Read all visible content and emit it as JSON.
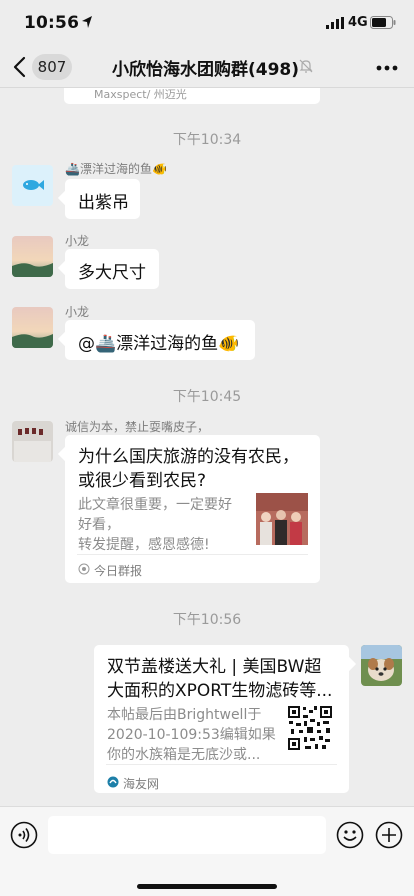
{
  "status_bar": {
    "time": "10:56",
    "network": "4G"
  },
  "header": {
    "back_badge": "807",
    "title": "小欣怡海水团购群(498)"
  },
  "chat": {
    "previous_snippet": "Maxspect/ 州迈光",
    "times": [
      "下午10:34",
      "下午10:45",
      "下午10:56"
    ],
    "messages": [
      {
        "sender": "🚢漂洋过海的鱼🐠",
        "text": "出紫吊"
      },
      {
        "sender": "小龙",
        "text": "多大尺寸"
      },
      {
        "sender": "小龙",
        "text": "@🚢漂洋过海的鱼🐠"
      }
    ],
    "card_left": {
      "sender": "诚信为本，禁止耍嘴皮子，",
      "title_line1": "为什么国庆旅游的没有农民，",
      "title_line2": "或很少看到农民?",
      "desc_line1": "此文章很重要，一定要好",
      "desc_line2": "好看，",
      "desc_line3": "转发提醒，感恩感德!",
      "source": "今日群报"
    },
    "card_right": {
      "title_line1": "双节盖楼送大礼 | 美国BW超",
      "title_line2": "大面积的XPORT生物滤砖等...",
      "desc_line1": "本帖最后由Brightwell于",
      "desc_line2": "2020-10-109:53编辑如果",
      "desc_line3": "你的水族箱是无底沙或...",
      "source": "海友网"
    }
  },
  "input_bar": {
    "placeholder": ""
  },
  "icons": [
    "location-arrow-icon",
    "signal-icon",
    "battery-icon",
    "back-icon",
    "mute-icon",
    "more-icon",
    "voice-icon",
    "emoji-icon",
    "plus-icon",
    "source-icon"
  ],
  "colors": {
    "background": "#ededed",
    "bubble": "#ffffff",
    "meta_text": "#9a9a9a",
    "input_bar": "#f6f6f6"
  }
}
